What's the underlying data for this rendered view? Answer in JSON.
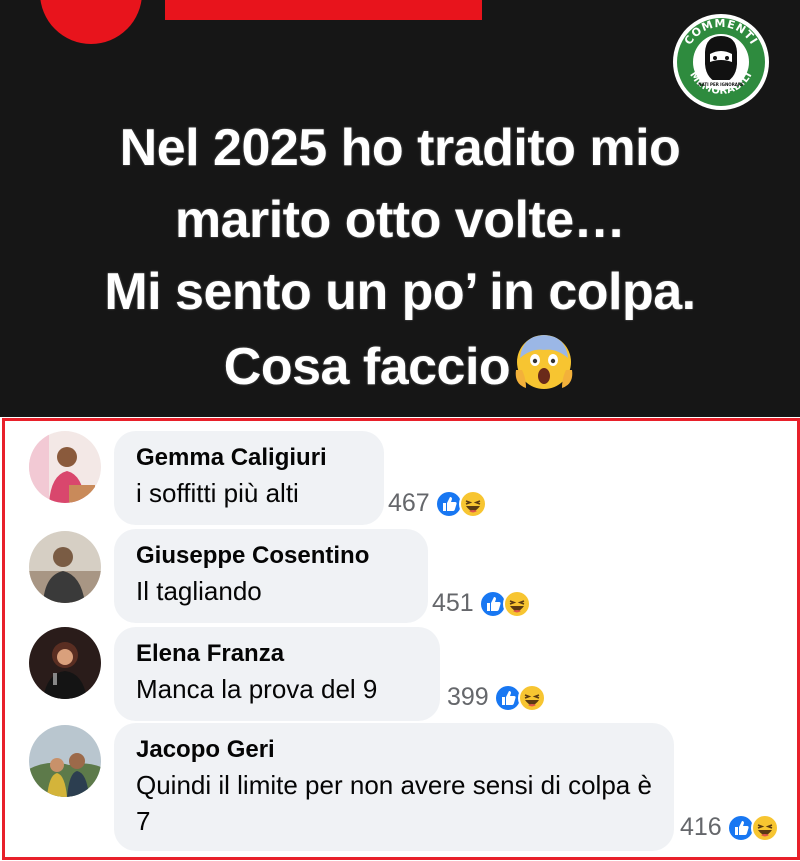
{
  "post": {
    "logo_text_top": "COMMENTI",
    "logo_text_bottom": "MEMORABILI",
    "logo_tagline": "NATI PER IGNORARE",
    "text_lines": [
      "Nel 2025 ho tradito mio",
      "marito otto volte…",
      "Mi sento un po’ in colpa.",
      "Cosa faccio"
    ],
    "emoji": "face-screaming-in-fear"
  },
  "colors": {
    "post_background": "#161616",
    "accent_red": "#e8141c",
    "logo_green": "#2e8b3e",
    "bubble": "#f0f2f5",
    "like_blue": "#1877f2",
    "haha_yellow": "#f7c531"
  },
  "comments": [
    {
      "author": "Gemma Caligiuri",
      "text": "i soffitti più alti",
      "count": "467",
      "reactions": [
        "like-icon",
        "haha-icon"
      ]
    },
    {
      "author": "Giuseppe Cosentino",
      "text": "Il tagliando",
      "count": "451",
      "reactions": [
        "like-icon",
        "haha-icon"
      ]
    },
    {
      "author": "Elena Franza",
      "text": "Manca la prova del 9",
      "count": "399",
      "reactions": [
        "like-icon",
        "haha-icon"
      ]
    },
    {
      "author": "Jacopo Geri",
      "text": "Quindi il limite per non avere sensi di colpa è 7",
      "count": "416",
      "reactions": [
        "like-icon",
        "haha-icon"
      ]
    }
  ]
}
